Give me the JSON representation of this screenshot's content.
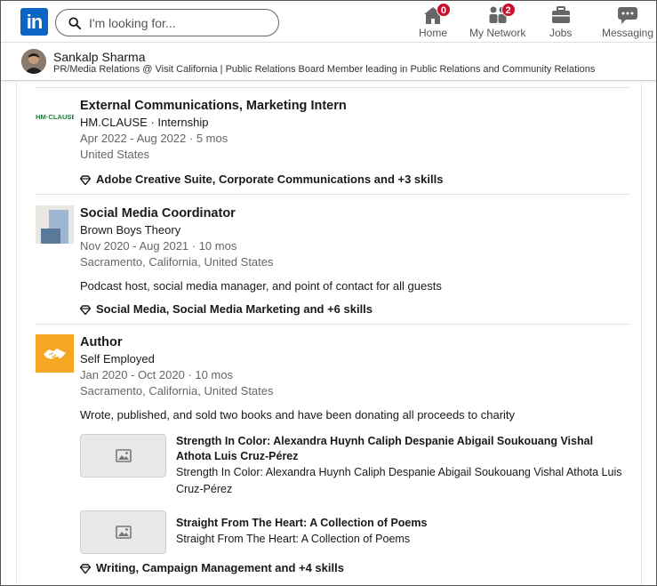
{
  "nav": {
    "logo_text": "in",
    "search_placeholder": "I'm looking for...",
    "items": [
      {
        "label": "Home",
        "icon": "home-icon",
        "badge": "0"
      },
      {
        "label": "My Network",
        "icon": "people-icon",
        "badge": "2"
      },
      {
        "label": "Jobs",
        "icon": "briefcase-icon",
        "badge": ""
      },
      {
        "label": "Messaging",
        "icon": "chat-icon",
        "badge": ""
      }
    ],
    "badge_color": "#cb112d",
    "brand_color": "#0a66c2"
  },
  "profile": {
    "name": "Sankalp Sharma",
    "headline": "PR/Media Relations @ Visit California | Public Relations Board Member leading in Public Relations and Community Relations"
  },
  "experience": [
    {
      "title": "External Communications, Marketing Intern",
      "company": "HM.CLAUSE · Internship",
      "dates": "Apr 2022 - Aug 2022 · 5 mos",
      "location": "United States",
      "skills": "Adobe Creative Suite, Corporate Communications and +3 skills",
      "logo_text": "HM·CLAUSE"
    },
    {
      "title": "Social Media Coordinator",
      "company": "Brown Boys Theory",
      "dates": "Nov 2020 - Aug 2021 · 10 mos",
      "location": "Sacramento, California, United States",
      "description": "Podcast host, social media manager, and point of contact for all guests",
      "skills": "Social Media, Social Media Marketing and +6 skills"
    },
    {
      "title": "Author",
      "company": "Self Employed",
      "dates": "Jan 2020 - Oct 2020 · 10 mos",
      "location": "Sacramento, California, United States",
      "description": "Wrote, published, and sold two books and have been donating all proceeds to charity",
      "media": [
        {
          "title": "Strength In Color: Alexandra Huynh Caliph Despanie Abigail Soukouang Vishal Athota Luis Cruz-Pérez",
          "subtitle": "Strength In Color: Alexandra Huynh Caliph Despanie Abigail Soukouang Vishal Athota Luis Cruz-Pérez"
        },
        {
          "title": "Straight From The Heart: A Collection of Poems",
          "subtitle": "Straight From The Heart: A Collection of Poems"
        }
      ],
      "skills": "Writing, Campaign Management and +4 skills"
    }
  ]
}
